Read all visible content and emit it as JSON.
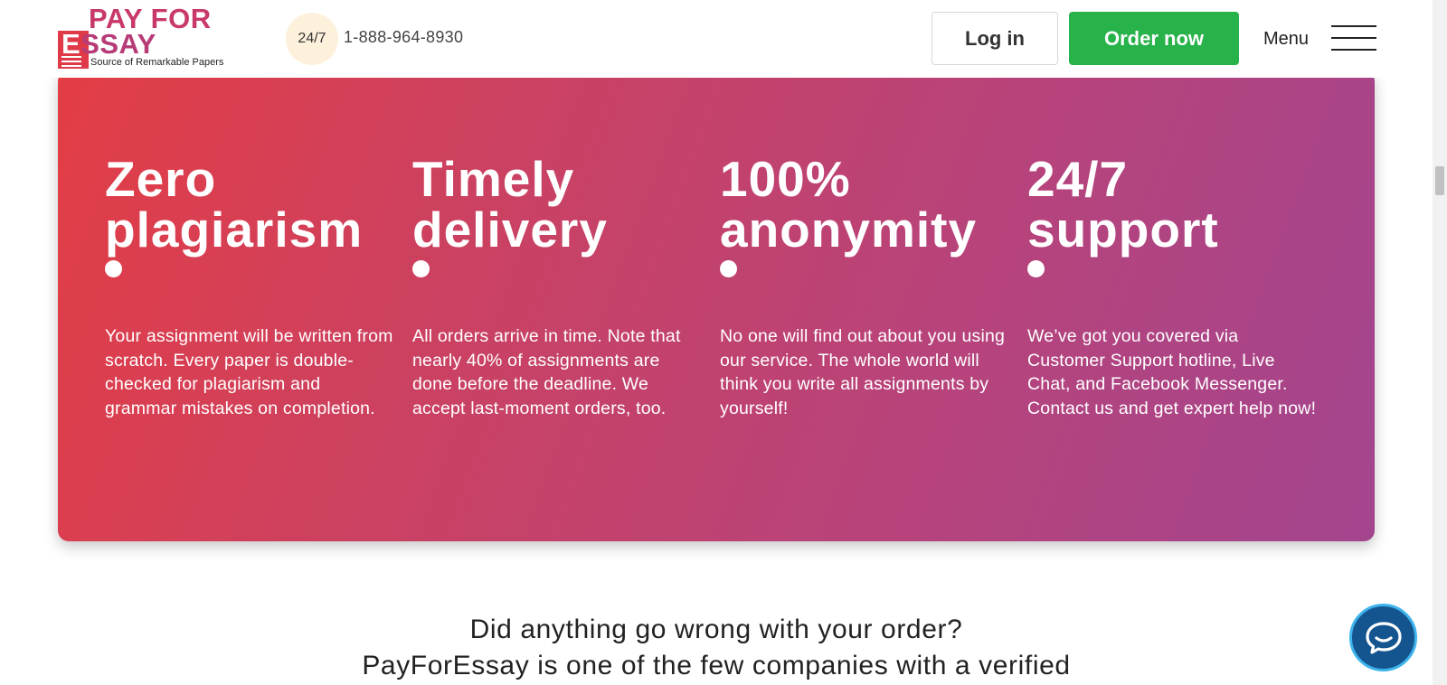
{
  "header": {
    "logo": {
      "line1": "PAY FOR",
      "line2_initial": "E",
      "line2_rest": "SSAY",
      "tagline": "Source of Remarkable Papers"
    },
    "support_badge": "24/7",
    "phone": "1-888-964-8930",
    "login_label": "Log in",
    "order_label": "Order now",
    "menu_label": "Menu"
  },
  "features": [
    {
      "title_line1": "Zero",
      "title_line2": "plagiarism",
      "text": "Your assignment will be written from scratch. Every paper is double-checked for plagiarism and grammar mistakes on completion."
    },
    {
      "title_line1": "Timely",
      "title_line2": "delivery",
      "text": "All orders arrive in time. Note that nearly 40% of assignments are done before the deadline. We accept last-moment orders, too."
    },
    {
      "title_line1": "100%",
      "title_line2": "anonymity",
      "text": "No one will find out about you using our service. The whole world will think you write all assignments by yourself!"
    },
    {
      "title_line1": "24/7",
      "title_line2": "support",
      "text": "We’ve got you covered via Customer Support hotline, Live Chat, and Facebook Messenger. Contact us and get expert help now!"
    }
  ],
  "bottom": {
    "line1": "Did anything go wrong with your order?",
    "line2": "PayForEssay is one of the few companies with a verified"
  },
  "colors": {
    "brand_pink": "#c8396a",
    "order_green": "#27b24a",
    "gradient_start": "#e33d45",
    "gradient_end": "#a3458e",
    "chat_blue": "#15558f"
  },
  "icons": {
    "chat": "chat-bubble-icon",
    "menu": "hamburger-icon"
  }
}
